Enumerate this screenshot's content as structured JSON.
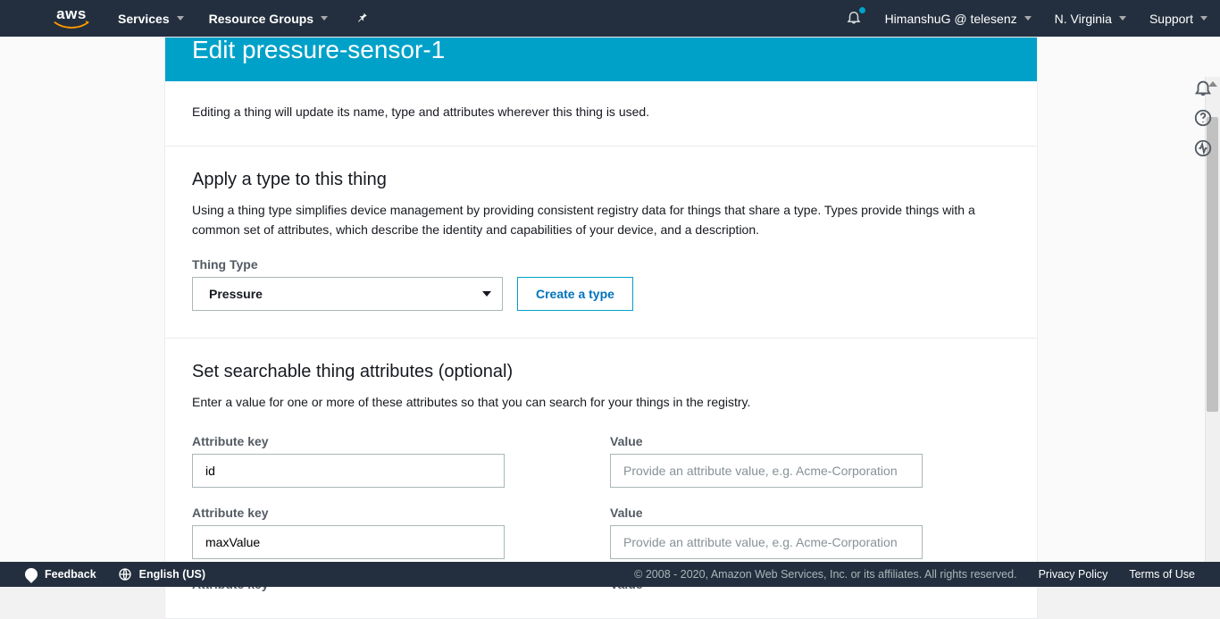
{
  "topnav": {
    "services": "Services",
    "resource_groups": "Resource Groups",
    "user": "HimanshuG @ telesenz",
    "region": "N. Virginia",
    "support": "Support"
  },
  "banner": {
    "title": "Edit pressure-sensor-1"
  },
  "intro": {
    "text": "Editing a thing will update its name, type and attributes wherever this thing is used."
  },
  "type_section": {
    "title": "Apply a type to this thing",
    "desc": "Using a thing type simplifies device management by providing consistent registry data for things that share a type. Types provide things with a common set of attributes, which describe the identity and capabilities of your device, and a description.",
    "field_label": "Thing Type",
    "selected": "Pressure",
    "create_btn": "Create a type"
  },
  "attrs_section": {
    "title": "Set searchable thing attributes (optional)",
    "desc": "Enter a value for one or more of these attributes so that you can search for your things in the registry.",
    "key_label": "Attribute key",
    "value_label": "Value",
    "value_placeholder": "Provide an attribute value, e.g. Acme-Corporation",
    "rows": [
      {
        "key": "id",
        "value": ""
      },
      {
        "key": "maxValue",
        "value": ""
      },
      {
        "key": "",
        "value": ""
      }
    ]
  },
  "footer": {
    "feedback": "Feedback",
    "language": "English (US)",
    "copyright": "© 2008 - 2020, Amazon Web Services, Inc. or its affiliates. All rights reserved.",
    "privacy": "Privacy Policy",
    "terms": "Terms of Use"
  }
}
